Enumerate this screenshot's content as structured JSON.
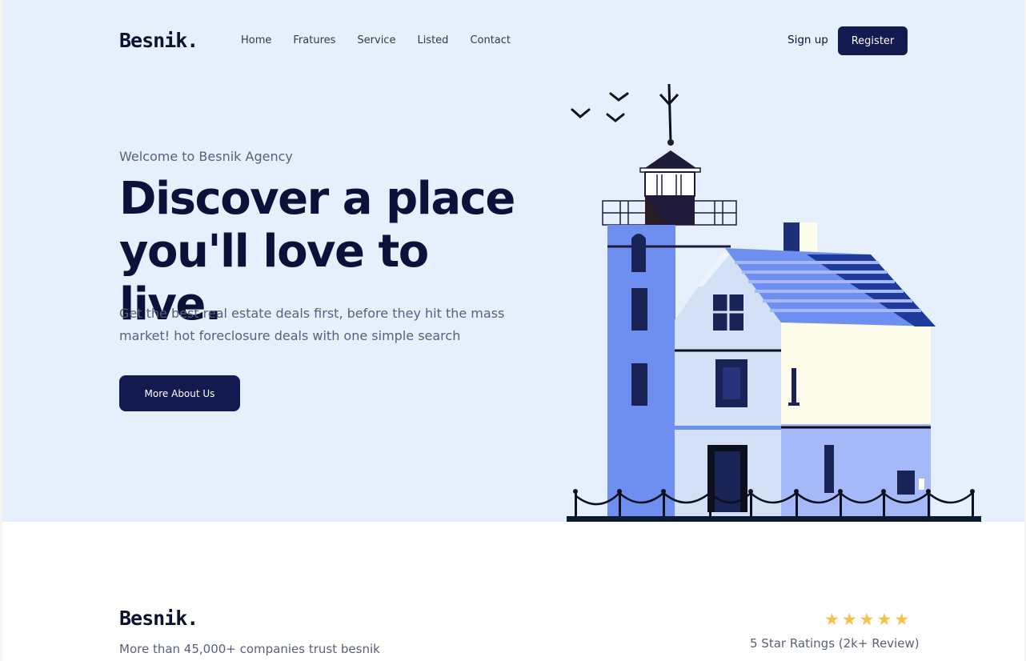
{
  "brand": {
    "logo": "Besnik."
  },
  "nav": {
    "items": [
      "Home",
      "Fratures",
      "Service",
      "Listed",
      "Contact"
    ]
  },
  "auth": {
    "signup": "Sign up",
    "register": "Register"
  },
  "hero": {
    "welcome": "Welcome to Besnik Agency",
    "headline_line1": "Discover a place",
    "headline_line2": "you'll love to live.",
    "subtext": "Get the best real estate deals first, before they hit the mass market! hot foreclosure deals with one simple search",
    "cta": "More About Us"
  },
  "trust": {
    "logo": "Besnik.",
    "text": "More than 45,000+ companies trust besnik",
    "stars": 5,
    "rating": "5 Star Ratings (2k+ Review)"
  },
  "colors": {
    "hero_bg": "#e6effc",
    "primary": "#121a4f",
    "heading": "#0b1138",
    "star": "#f7c04a"
  }
}
